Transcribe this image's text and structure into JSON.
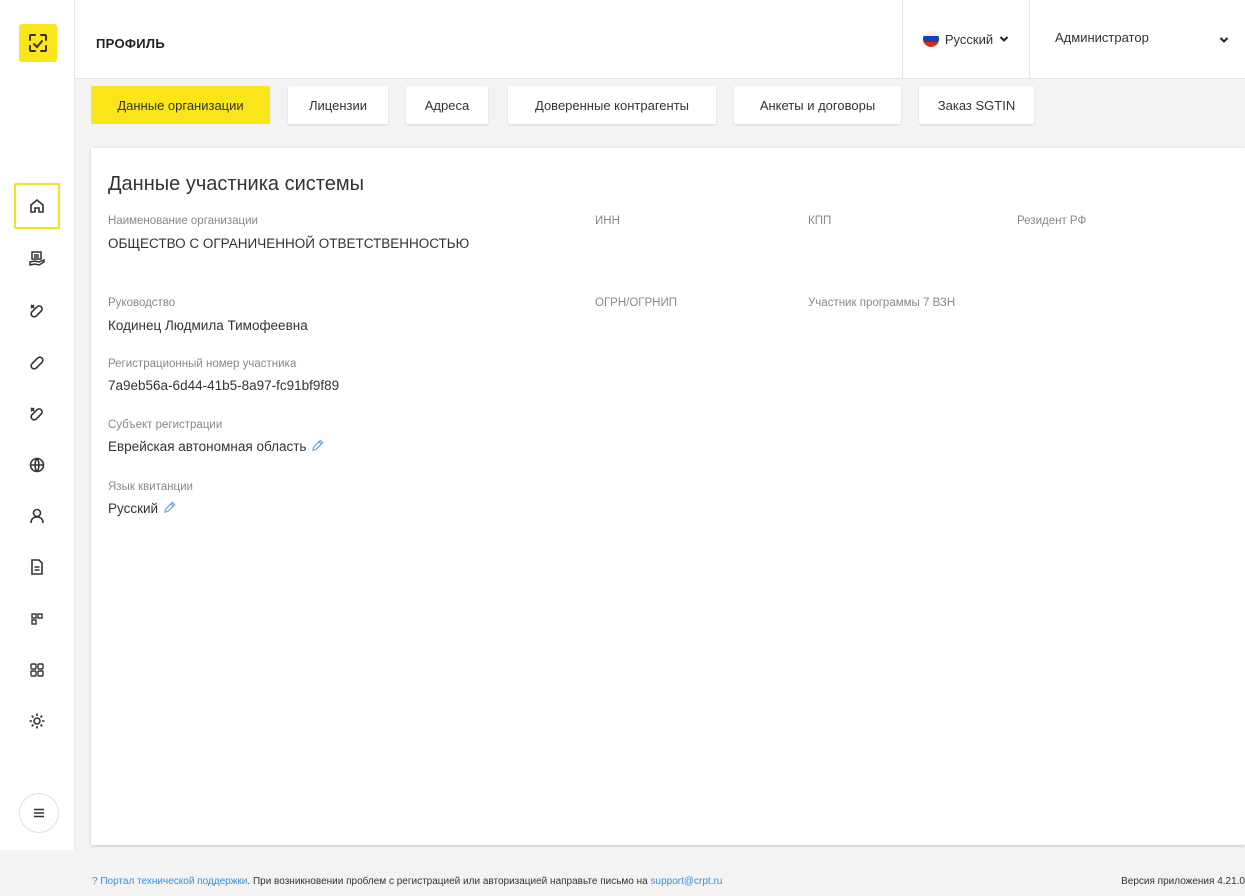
{
  "header": {
    "title": "ПРОФИЛЬ",
    "language": "Русский",
    "user": "Администратор"
  },
  "tabs": [
    {
      "label": "Данные организации",
      "active": true
    },
    {
      "label": "Лицензии"
    },
    {
      "label": "Адреса"
    },
    {
      "label": "Доверенные контрагенты"
    },
    {
      "label": "Анкеты и договоры"
    },
    {
      "label": "Заказ SGTIN"
    }
  ],
  "card": {
    "title": "Данные участника системы",
    "org_name_label": "Наименование организации",
    "org_name_value": "ОБЩЕСТВО С ОГРАНИЧЕННОЙ ОТВЕТСТВЕННОСТЬЮ",
    "inn_label": "ИНН",
    "kpp_label": "КПП",
    "resident_label": "Резидент РФ",
    "management_label": "Руководство",
    "management_value": "Кодинец Людмила Тимофеевна",
    "ogrn_label": "ОГРН/ОГРНИП",
    "program_label": "Участник программы 7 ВЗН",
    "reg_number_label": "Регистрационный номер участника",
    "reg_number_value": "7a9eb56a-6d44-41b5-8a97-fc91bf9f89",
    "subject_label": "Субъект регистрации",
    "subject_value": "Еврейская автономная область",
    "receipt_lang_label": "Язык квитанции",
    "receipt_lang_value": "Русский"
  },
  "footer": {
    "portal_link": "Портал технической поддержки",
    "message": ". При возникновении проблем с регистрацией или авторизацией направьте письмо на ",
    "email": "support@crpt.ru",
    "version": "Версия приложения 4.21.0"
  },
  "colors": {
    "accent": "#f9e51a",
    "link": "#3a8dde",
    "edit_icon": "#6aa6e6"
  },
  "icons": {
    "logo": "scan-logo-icon",
    "nav": [
      "home-icon",
      "receipt-stack-icon",
      "pill-cross-icon",
      "pill-icon",
      "pill-cross-icon",
      "globe-icon",
      "user-icon",
      "document-icon",
      "apps-small-icon",
      "apps-grid-icon",
      "gear-icon"
    ],
    "menu": "hamburger-icon"
  }
}
